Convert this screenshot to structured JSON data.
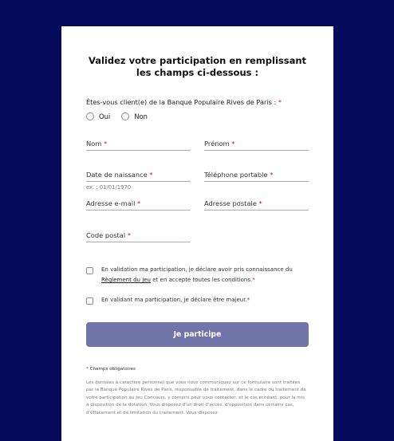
{
  "form": {
    "title": "Validez votre participation en remplissant les champs ci-dessous :",
    "client_question": "Êtes-vous client(e) de la Banque Populaire Rives de Paris :",
    "required_mark": "*",
    "options": [
      "Oui",
      "Non"
    ],
    "fields": {
      "nom": "Nom",
      "prenom": "Prénom",
      "naissance": "Date de naissance",
      "naissance_hint": "ex. : 01/01/1970",
      "telephone": "Téléphone portable",
      "email": "Adresse e-mail",
      "adresse": "Adresse postale",
      "code_postal": "Code postal"
    },
    "consent1_a": "En validation ma participation, je déclare avoir pris connaissance du",
    "consent1_link": "Règlement du Jeu",
    "consent1_b": "et en accepte toutes les conditions.",
    "consent2": "En validant ma participation, je déclare être majeur.",
    "submit_label": "Je participe",
    "required_note": "Champs obligatoires",
    "legal_text": "Les données à caractère personnel que vous nous communiquez sur ce formulaire sont traitées par la Banque Populaire Rives de Paris, responsable de traitement, dans le cadre du traitement de votre participation au Jeu Concours, y compris pour vous contacter, et le cas échéant, pour la mis à disposition de la dotation. Vous disposez d'un droit d'accès, d'opposition dans certains cas, d'effacement et de limitation du traitement. Vous disposez"
  },
  "colors": {
    "background": "#050a5c",
    "button": "#6f74a9",
    "required": "#c8102e"
  }
}
